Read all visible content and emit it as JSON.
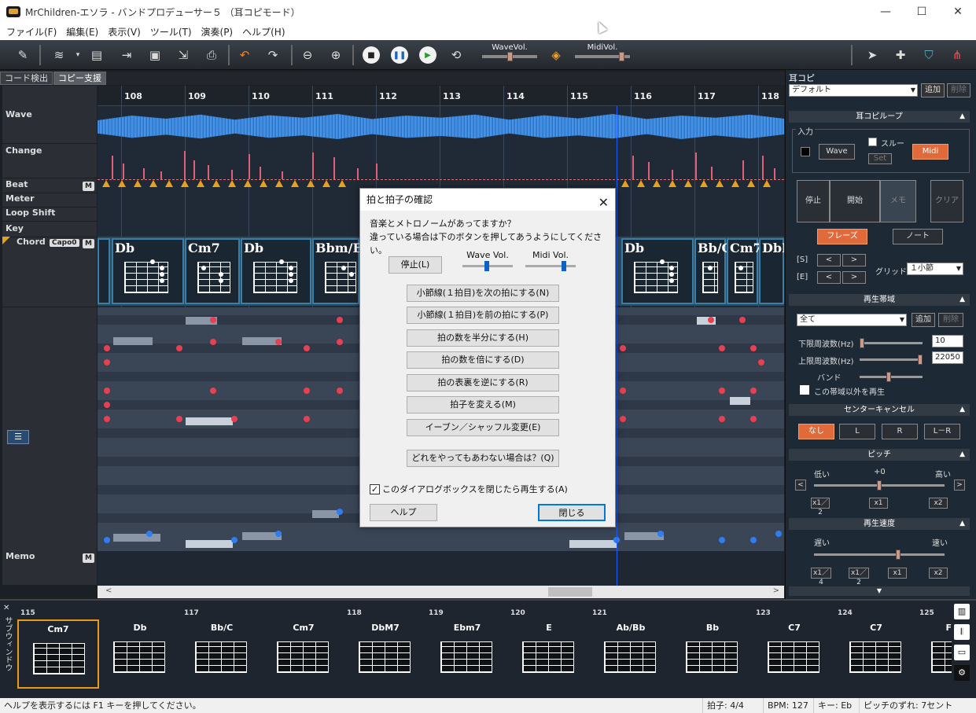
{
  "window": {
    "title": "MrChildren-エソラ - バンドプロデューサー５ （耳コピモード）",
    "minimize": "—",
    "maximize": "☐",
    "close": "✕"
  },
  "menu": [
    "ファイル(F)",
    "編集(E)",
    "表示(V)",
    "ツール(T)",
    "演奏(P)",
    "ヘルプ(H)"
  ],
  "toolbar": {
    "wave_vol_label": "WaveVol.",
    "midi_vol_label": "MidiVol."
  },
  "tabs": [
    "コード検出",
    "コピー支援"
  ],
  "track_labels": {
    "wave": "Wave",
    "change": "Change",
    "beat": "Beat",
    "meter": "Meter",
    "loop_shift": "Loop Shift",
    "key": "Key",
    "chord": "Chord",
    "capo": "Capo0",
    "memo": "Memo",
    "m": "M"
  },
  "measures": [
    "108",
    "109",
    "110",
    "111",
    "112",
    "113",
    "114",
    "115",
    "116",
    "117",
    "118"
  ],
  "chords_main": [
    {
      "name": "Db"
    },
    {
      "name": "Cm7"
    },
    {
      "name": "Db"
    },
    {
      "name": "Bbm/Eb"
    },
    {
      "name": "Db"
    },
    {
      "name": "Bb/C"
    },
    {
      "name": "Cm7"
    },
    {
      "name": "DbM"
    }
  ],
  "fret_numbers": [
    "4",
    "5",
    "6",
    "7"
  ],
  "dialog": {
    "title": "拍と拍子の確認",
    "message_line1": "音楽とメトロノームがあってますか？",
    "message_line2": "違っている場合は下のボタンを押してあうようにしてください。",
    "stop_button": "停止(L)",
    "wave_vol": "Wave Vol.",
    "midi_vol": "Midi Vol.",
    "options": [
      "小節線(１拍目)を次の拍にする(N)",
      "小節線(１拍目)を前の拍にする(P)",
      "拍の数を半分にする(H)",
      "拍の数を倍にする(D)",
      "拍の表裏を逆にする(R)",
      "拍子を変える(M)",
      "イーブン／シャッフル変更(E)"
    ],
    "none_button": "どれをやってもあわない場合は？(Q)",
    "checkbox_label": "このダイアログボックスを閉じたら再生する(A)",
    "checkbox_checked": "✓",
    "help_button": "ヘルプ",
    "close_button": "閉じる"
  },
  "right_panel": {
    "title": "耳コピ",
    "preset": "デフォルト",
    "add": "追加",
    "delete": "削除",
    "section_loop": "耳コピループ",
    "input_label": "入力",
    "wave_btn": "Wave",
    "thru": "スルー",
    "set": "Set",
    "midi_btn": "Midi",
    "stop": "停止",
    "start": "開始",
    "memo": "メモ",
    "clear": "クリア",
    "phrase": "フレーズ",
    "note": "ノート",
    "s_label": "[S]",
    "e_label": "[E]",
    "lt": "<",
    "gt": ">",
    "grid_label": "グリッド",
    "grid_value": "１小節",
    "section_band": "再生帯域",
    "band_value": "全て",
    "low_freq_label": "下限周波数(Hz)",
    "low_freq_value": "10",
    "high_freq_label": "上限周波数(Hz)",
    "high_freq_value": "22050",
    "band_label": "バンド",
    "other_band": "この帯域以外を再生",
    "section_center": "センターキャンセル",
    "center_options": [
      "なし",
      "L",
      "R",
      "L－R"
    ],
    "section_pitch": "ピッチ",
    "pitch_low": "低い",
    "pitch_zero": "+0",
    "pitch_high": "高い",
    "pitch_buttons": [
      "x1／2",
      "x1",
      "x2"
    ],
    "section_speed": "再生速度",
    "speed_slow": "遅い",
    "speed_fast": "速い",
    "speed_buttons": [
      "x1／4",
      "x1／2",
      "x1",
      "x2"
    ]
  },
  "sub_window": {
    "title": "サブウィンドウ",
    "numbers": [
      "115",
      "117",
      "118",
      "119",
      "120",
      "121",
      "123",
      "124",
      "125"
    ],
    "chords": [
      "Cm7",
      "Db",
      "Bb/C",
      "Cm7",
      "DbM7",
      "Ebm7",
      "E",
      "Ab/Bb",
      "Bb",
      "C7",
      "C7",
      "F"
    ]
  },
  "status": {
    "help": "ヘルプを表示するには F1 キーを押してください。",
    "meter": "拍子: 4/4",
    "bpm": "BPM: 127",
    "key": "キー: Eb",
    "pitch": "ピッチのずれ: 7セント"
  }
}
